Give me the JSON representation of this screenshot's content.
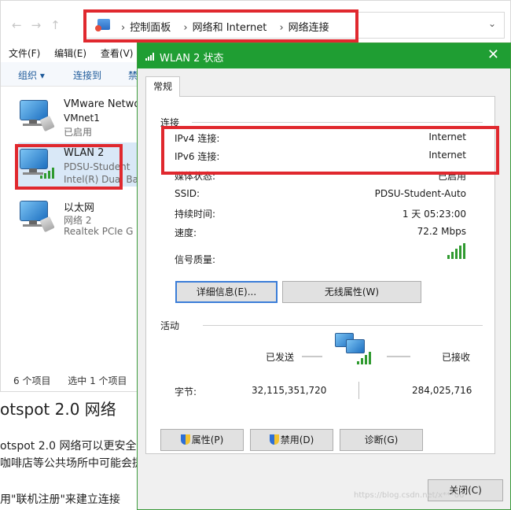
{
  "explorer": {
    "breadcrumb": [
      "控制面板",
      "网络和 Internet",
      "网络连接"
    ],
    "menu": [
      "文件(F)",
      "编辑(E)",
      "查看(V)"
    ],
    "toolbar": {
      "organize": "组织 ▾",
      "connect_to": "连接到",
      "disable_partial": "禁"
    },
    "connections": [
      {
        "name": "VMware Netwo",
        "sub1": "VMnet1",
        "sub2": "已启用"
      },
      {
        "name": "WLAN 2",
        "sub1": "PDSU-Student",
        "sub2": "Intel(R) Dual Ba"
      },
      {
        "name": "以太网",
        "sub1": "网络 2",
        "sub2": "Realtek PCIe G"
      }
    ],
    "status": {
      "count": "6 个项目",
      "selected": "选中 1 个项目"
    }
  },
  "background": {
    "heading": "otspot 2.0 网络",
    "line1": "otspot 2.0 网络可以更安全",
    "line2": "咖啡店等公共场所中可能会提",
    "line3": "用\"联机注册\"来建立连接"
  },
  "dialog": {
    "title": "WLAN 2 状态",
    "close_glyph": "✕",
    "tab": "常规",
    "connection": {
      "label": "连接",
      "rows": [
        {
          "label": "IPv4 连接:",
          "value": "Internet"
        },
        {
          "label": "IPv6 连接:",
          "value": "Internet"
        },
        {
          "label": "媒体状态:",
          "value": "已启用"
        },
        {
          "label": "SSID:",
          "value": "PDSU-Student-Auto"
        },
        {
          "label": "持续时间:",
          "value": "1 天 05:23:00"
        },
        {
          "label": "速度:",
          "value": "72.2 Mbps"
        }
      ],
      "signal_label": "信号质量:"
    },
    "buttons": {
      "details": "详细信息(E)...",
      "wireless_props": "无线属性(W)"
    },
    "activity": {
      "label": "活动",
      "sent": "已发送",
      "received": "已接收",
      "bytes_label": "字节:",
      "bytes_sent": "32,115,351,720",
      "bytes_received": "284,025,716"
    },
    "footer": {
      "properties": "属性(P)",
      "disable": "禁用(D)",
      "diagnose": "诊断(G)",
      "close": "关闭(C)"
    }
  },
  "watermark": "https://blog.csdn.net/x***o6",
  "colors": {
    "title_bar": "#1f9e33",
    "highlight_box": "#e0282e",
    "signal": "#2f9a2f"
  }
}
